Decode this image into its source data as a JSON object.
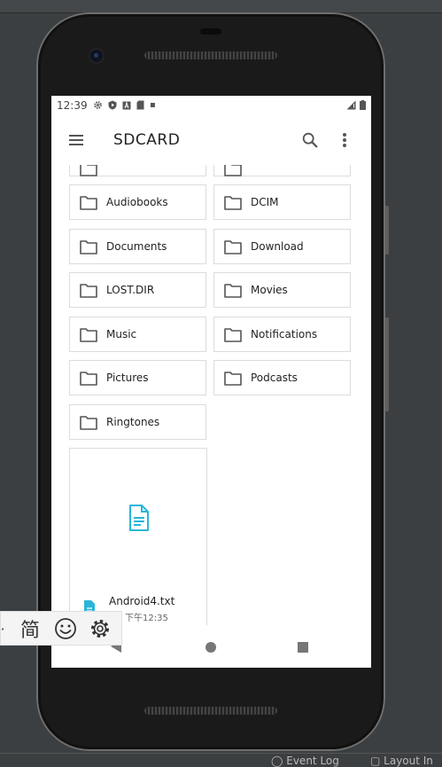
{
  "statusbar": {
    "time": "12:39"
  },
  "appbar": {
    "title": "SDCARD"
  },
  "folders": [
    {
      "name": "Audiobooks"
    },
    {
      "name": "DCIM"
    },
    {
      "name": "Documents"
    },
    {
      "name": "Download"
    },
    {
      "name": "LOST.DIR"
    },
    {
      "name": "Movies"
    },
    {
      "name": "Music"
    },
    {
      "name": "Notifications"
    },
    {
      "name": "Pictures"
    },
    {
      "name": "Podcasts"
    },
    {
      "name": "Ringtones"
    }
  ],
  "file": {
    "name": "Android4.txt",
    "date": "下午12:35"
  },
  "ime": {
    "mode_char": "简",
    "dot": "·"
  },
  "ide_bottom": {
    "event_log": "Event Log",
    "layout": "Layout In"
  },
  "colors": {
    "accent": "#29b6d8",
    "folder_icon": "#555555"
  }
}
